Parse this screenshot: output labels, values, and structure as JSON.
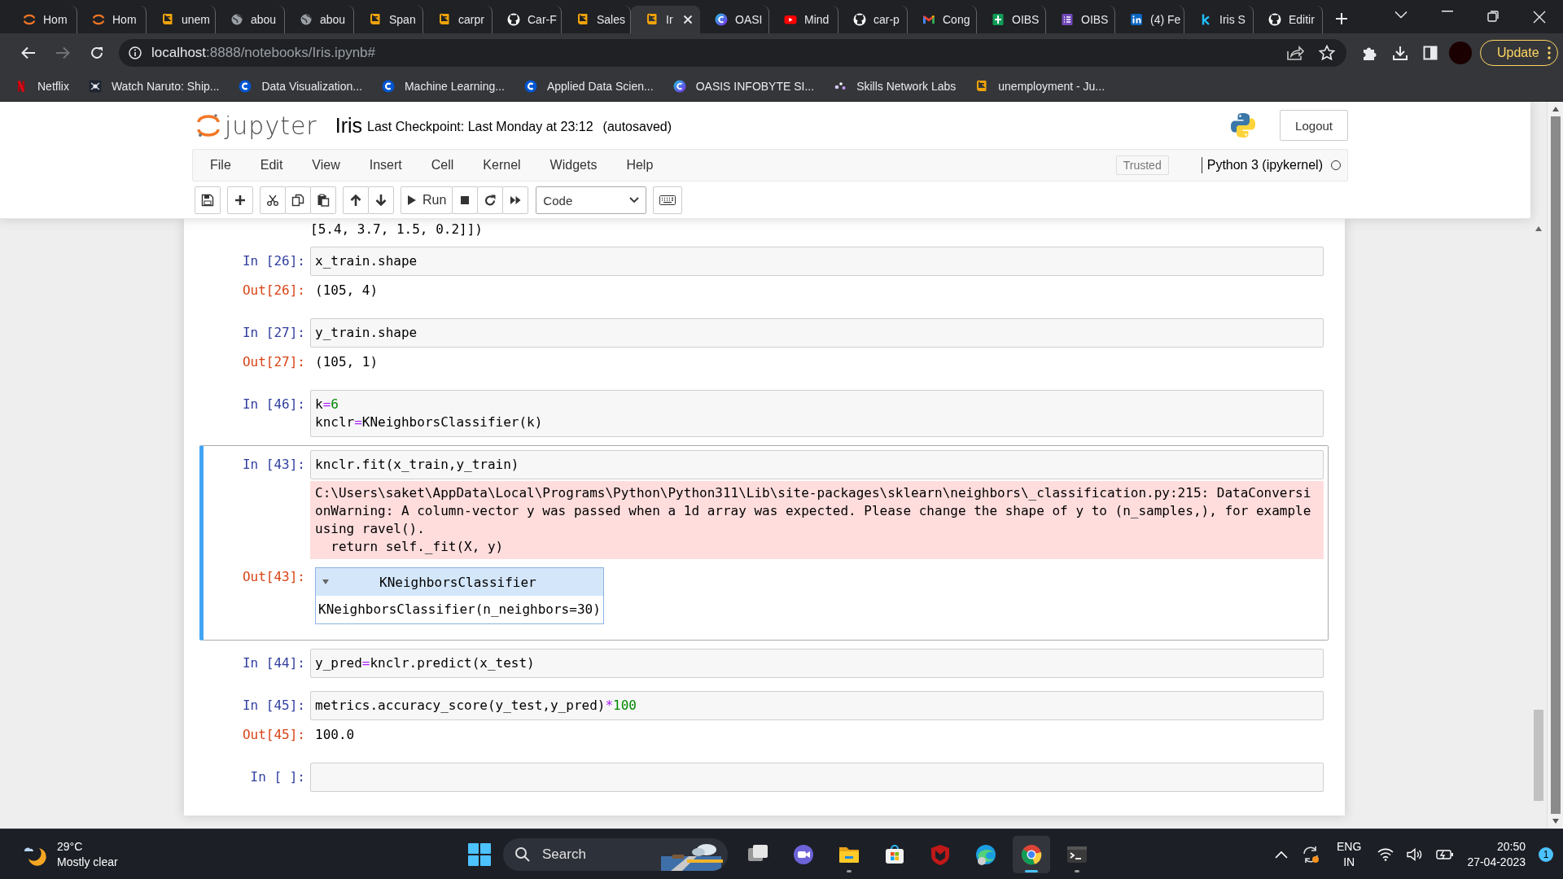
{
  "browser": {
    "tabs": [
      {
        "title": "Hom",
        "kind": "jupyter",
        "selected": false
      },
      {
        "title": "Hom",
        "kind": "jupyter",
        "selected": false
      },
      {
        "title": "unem",
        "kind": "book",
        "selected": false
      },
      {
        "title": "abou",
        "kind": "globe",
        "selected": false
      },
      {
        "title": "abou",
        "kind": "globe",
        "selected": false
      },
      {
        "title": "Span",
        "kind": "book",
        "selected": false
      },
      {
        "title": "carpr",
        "kind": "book",
        "selected": false
      },
      {
        "title": "Car-F",
        "kind": "repo",
        "selected": false
      },
      {
        "title": "Sales",
        "kind": "book",
        "selected": false
      },
      {
        "title": "Ir",
        "kind": "book",
        "selected": true
      },
      {
        "title": "OASI",
        "kind": "canva",
        "selected": false
      },
      {
        "title": "Mind",
        "kind": "video",
        "selected": false
      },
      {
        "title": "car-p",
        "kind": "repo",
        "selected": false
      },
      {
        "title": "Cong",
        "kind": "mail",
        "selected": false
      },
      {
        "title": "OIBS",
        "kind": "sheet",
        "selected": false
      },
      {
        "title": "OIBS",
        "kind": "form",
        "selected": false
      },
      {
        "title": "(4) Fe",
        "kind": "linkedin",
        "selected": false
      },
      {
        "title": "Iris S",
        "kind": "kaggle",
        "selected": false
      },
      {
        "title": "Editir",
        "kind": "repo",
        "selected": false
      }
    ],
    "address": {
      "host": "localhost",
      "path": ":8888/notebooks/Iris.ipynb#"
    },
    "update_button": "Update",
    "bookmarks": [
      {
        "title": "Netflix",
        "kind": "netflix"
      },
      {
        "title": "Watch Naruto: Ship...",
        "kind": "emblem"
      },
      {
        "title": "Data Visualization...",
        "kind": "course"
      },
      {
        "title": "Machine Learning...",
        "kind": "course"
      },
      {
        "title": "Applied Data Scien...",
        "kind": "course"
      },
      {
        "title": "OASIS INFOBYTE SI...",
        "kind": "canva"
      },
      {
        "title": "Skills Network Labs",
        "kind": "dots"
      },
      {
        "title": "unemployment - Ju...",
        "kind": "book"
      }
    ]
  },
  "jupyter": {
    "logo_text": "jupyter",
    "notebook_name": "Iris",
    "checkpoint": "Last Checkpoint: Last Monday at 23:12",
    "autosave": "(autosaved)",
    "logout": "Logout",
    "menu": [
      "File",
      "Edit",
      "View",
      "Insert",
      "Cell",
      "Kernel",
      "Widgets",
      "Help"
    ],
    "trusted": "Trusted",
    "kernel": "Python 3 (ipykernel)",
    "kernel_busy": false,
    "toolbar": {
      "run": "Run",
      "cell_type": "Code"
    }
  },
  "notebook": {
    "partial_output": "[5.4, 3.7, 1.5, 0.2]])",
    "cells": [
      {
        "prompt": "In [26]:",
        "source": "x_train.shape",
        "selected": false,
        "outputs": [
          {
            "kind": "text",
            "prompt": "Out[26]:",
            "text": "(105, 4)"
          }
        ]
      },
      {
        "prompt": "In [27]:",
        "source": "y_train.shape",
        "selected": false,
        "outputs": [
          {
            "kind": "text",
            "prompt": "Out[27]:",
            "text": "(105, 1)"
          }
        ]
      },
      {
        "prompt": "In [46]:",
        "source": "k=6\nknclr=KNeighborsClassifier(k)",
        "selected": false
      },
      {
        "prompt": "In [43]:",
        "source": "knclr.fit(x_train,y_train)",
        "selected": true,
        "outputs": [
          {
            "kind": "stderr",
            "text": "C:\\Users\\saket\\AppData\\Local\\Programs\\Python\\Python311\\Lib\\site-packages\\sklearn\\neighbors\\_classification.py:215: DataConversi\nonWarning: A column-vector y was passed when a 1d array was expected. Please change the shape of y to (n_samples,), for example\nusing ravel().\n  return self._fit(X, y)"
          },
          {
            "kind": "widget",
            "prompt": "Out[43]:",
            "title": "KNeighborsClassifier",
            "repr": "KNeighborsClassifier(n_neighbors=30)"
          }
        ]
      },
      {
        "prompt": "In [44]:",
        "source": "y_pred=knclr.predict(x_test)",
        "selected": false
      },
      {
        "prompt": "In [45]:",
        "source": "metrics.accuracy_score(y_test,y_pred)*100",
        "selected": false,
        "outputs": [
          {
            "kind": "text",
            "prompt": "Out[45]:",
            "text": "100.0"
          }
        ]
      },
      {
        "prompt": "In [ ]:",
        "selected": false
      }
    ]
  },
  "taskbar": {
    "weather": {
      "temperature": "29°C",
      "condition": "Mostly clear"
    },
    "search": "Search",
    "apps": [
      {
        "kind": "taskview",
        "running": false,
        "active": false
      },
      {
        "kind": "chat",
        "running": false,
        "active": false
      },
      {
        "kind": "explorer",
        "running": true,
        "active": false
      },
      {
        "kind": "store",
        "running": false,
        "active": false
      },
      {
        "kind": "shield",
        "running": false,
        "active": false
      },
      {
        "kind": "edge",
        "running": false,
        "active": false
      },
      {
        "kind": "chrome",
        "running": true,
        "active": true
      },
      {
        "kind": "terminal",
        "running": true,
        "active": false
      }
    ],
    "language": "ENG",
    "region": "IN",
    "time": "20:50",
    "date": "27-04-2023",
    "notification_count": "1"
  }
}
